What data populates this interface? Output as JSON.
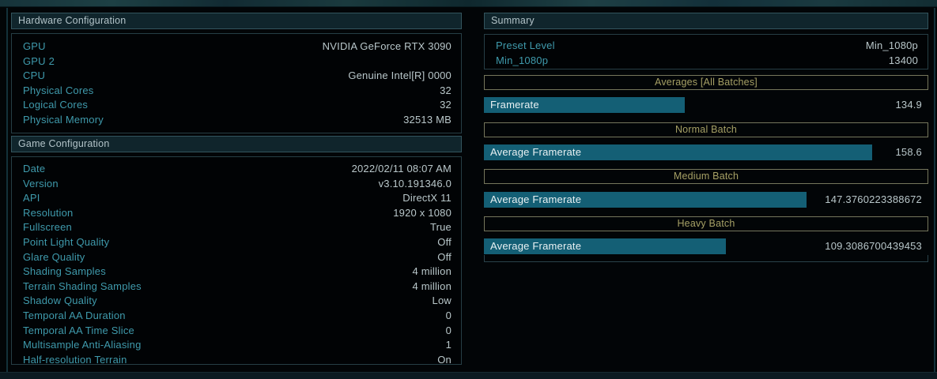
{
  "hardware": {
    "title": "Hardware Configuration",
    "rows": [
      {
        "label": "GPU",
        "value": "NVIDIA GeForce RTX 3090"
      },
      {
        "label": "GPU 2",
        "value": ""
      },
      {
        "label": "CPU",
        "value": "Genuine Intel[R] 0000"
      },
      {
        "label": "Physical Cores",
        "value": "32"
      },
      {
        "label": "Logical Cores",
        "value": "32"
      },
      {
        "label": "Physical Memory",
        "value": "32513 MB"
      }
    ]
  },
  "game": {
    "title": "Game Configuration",
    "rows": [
      {
        "label": "Date",
        "value": "2022/02/11 08:07 AM"
      },
      {
        "label": "Version",
        "value": "v3.10.191346.0"
      },
      {
        "label": "API",
        "value": "DirectX 11"
      },
      {
        "label": "Resolution",
        "value": "1920 x 1080"
      },
      {
        "label": "Fullscreen",
        "value": "True"
      },
      {
        "label": "Point Light Quality",
        "value": "Off"
      },
      {
        "label": "Glare Quality",
        "value": "Off"
      },
      {
        "label": "Shading Samples",
        "value": "4 million"
      },
      {
        "label": "Terrain Shading Samples",
        "value": "4 million"
      },
      {
        "label": "Shadow Quality",
        "value": "Low"
      },
      {
        "label": "Temporal AA Duration",
        "value": "0"
      },
      {
        "label": "Temporal AA Time Slice",
        "value": "0"
      },
      {
        "label": "Multisample Anti-Aliasing",
        "value": "1"
      },
      {
        "label": "Half-resolution Terrain",
        "value": "On"
      }
    ]
  },
  "summary": {
    "title": "Summary",
    "rows": [
      {
        "label": "Preset Level",
        "value": "Min_1080p"
      },
      {
        "label": "Min_1080p",
        "value": "13400"
      }
    ],
    "sections": [
      {
        "header": "Averages [All Batches]",
        "bar_label": "Framerate",
        "value": "134.9",
        "bar_pct": 45.2
      },
      {
        "header": "Normal Batch",
        "bar_label": "Average Framerate",
        "value": "158.6",
        "bar_pct": 87.4
      },
      {
        "header": "Medium Batch",
        "bar_label": "Average Framerate",
        "value": "147.3760223388672",
        "bar_pct": 72.6
      },
      {
        "header": "Heavy Batch",
        "bar_label": "Average Framerate",
        "value": "109.3086700439453",
        "bar_pct": 54.4
      }
    ]
  },
  "colors": {
    "bar_fill": "#145f75",
    "label_teal": "#3f9aac",
    "value_gray": "#b9c7ca",
    "batch_header_text": "#a6a065",
    "section_header_bg": "#10252c"
  }
}
